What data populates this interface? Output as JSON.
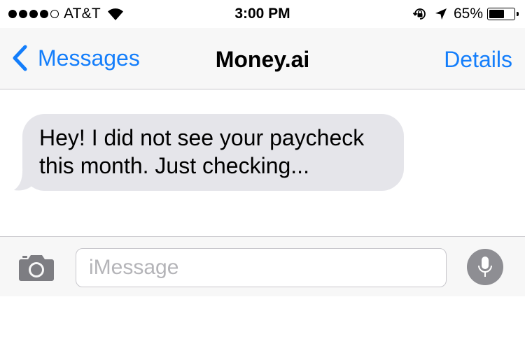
{
  "status_bar": {
    "signal_bars_filled": 4,
    "signal_bars_total": 5,
    "carrier": "AT&T",
    "wifi_icon": "wifi-icon",
    "time": "3:00 PM",
    "rotation_lock_icon": "rotation-lock-icon",
    "location_icon": "location-arrow-icon",
    "battery_percent": "65%",
    "battery_level": 0.65
  },
  "nav": {
    "back_label": "Messages",
    "back_icon": "chevron-left-icon",
    "title": "Money.ai",
    "details_label": "Details"
  },
  "conversation": {
    "messages": [
      {
        "direction": "incoming",
        "lines": [
          "Hey! I did not see your paycheck",
          "this month. Just checking..."
        ]
      }
    ]
  },
  "input_bar": {
    "camera_icon": "camera-icon",
    "placeholder": "iMessage",
    "value": "",
    "mic_icon": "microphone-icon"
  },
  "colors": {
    "accent": "#147efb",
    "incoming_bubble": "#e5e5ea",
    "bar_background": "#f7f7f7",
    "separator": "#c8c7cc",
    "mic_button": "#8e8e93",
    "placeholder_text": "#b4b4b8"
  }
}
